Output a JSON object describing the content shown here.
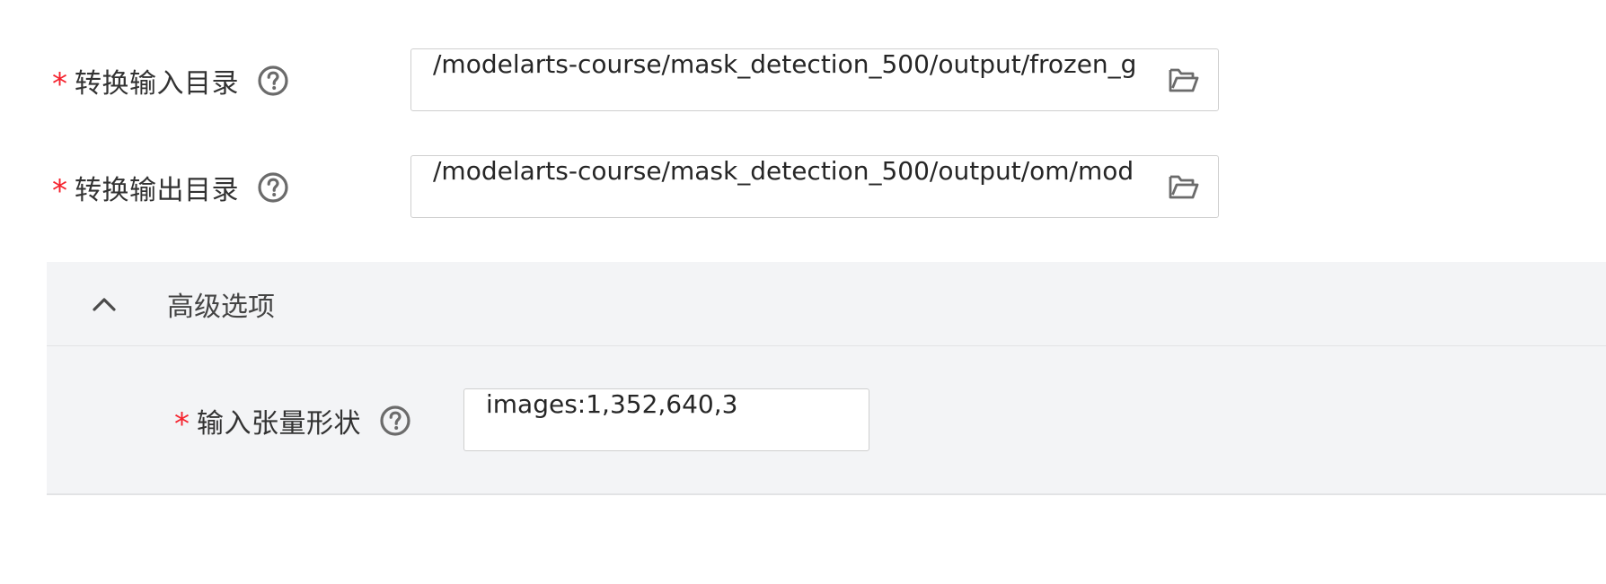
{
  "form": {
    "input_dir": {
      "required_mark": "*",
      "label": "转换输入目录",
      "value": "/modelarts-course/mask_detection_500/output/frozen_g"
    },
    "output_dir": {
      "required_mark": "*",
      "label": "转换输出目录",
      "value": "/modelarts-course/mask_detection_500/output/om/mod"
    }
  },
  "advanced": {
    "title": "高级选项",
    "expanded": true,
    "tensor_shape": {
      "required_mark": "*",
      "label": "输入张量形状",
      "value": "images:1,352,640,3"
    }
  },
  "icons": {
    "help": "help-circle-icon",
    "folder": "folder-open-icon",
    "chevron": "chevron-up-icon"
  },
  "colors": {
    "required": "#f5222d",
    "icon": "#6b6b6b",
    "section_bg": "#f3f4f6",
    "border": "#cfcfcf"
  }
}
